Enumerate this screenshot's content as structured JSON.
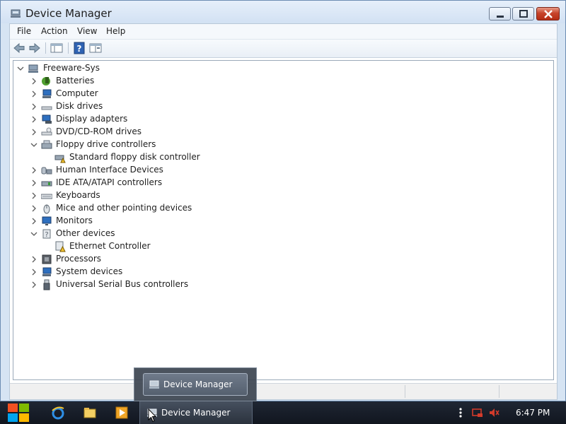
{
  "window": {
    "title": "Device Manager"
  },
  "menu": [
    "File",
    "Action",
    "View",
    "Help"
  ],
  "toolbar": {
    "back_icon": "back-arrow-icon",
    "forward_icon": "forward-arrow-icon",
    "show_hide_icon": "console-tree-icon",
    "help_icon": "help-icon",
    "properties_icon": "properties-icon"
  },
  "tree": {
    "root": "Freeware-Sys",
    "items": [
      {
        "label": "Batteries",
        "icon": "battery-icon",
        "expanded": false
      },
      {
        "label": "Computer",
        "icon": "computer-icon",
        "expanded": false
      },
      {
        "label": "Disk drives",
        "icon": "disk-drive-icon",
        "expanded": false
      },
      {
        "label": "Display adapters",
        "icon": "display-adapter-icon",
        "expanded": false
      },
      {
        "label": "DVD/CD-ROM drives",
        "icon": "dvd-drive-icon",
        "expanded": false
      },
      {
        "label": "Floppy drive controllers",
        "icon": "floppy-controller-icon",
        "expanded": true,
        "children": [
          {
            "label": "Standard floppy disk controller",
            "icon": "floppy-controller-warning-icon"
          }
        ]
      },
      {
        "label": "Human Interface Devices",
        "icon": "hid-icon",
        "expanded": false
      },
      {
        "label": "IDE ATA/ATAPI controllers",
        "icon": "ide-controller-icon",
        "expanded": false
      },
      {
        "label": "Keyboards",
        "icon": "keyboard-icon",
        "expanded": false
      },
      {
        "label": "Mice and other pointing devices",
        "icon": "mouse-icon",
        "expanded": false
      },
      {
        "label": "Monitors",
        "icon": "monitor-icon",
        "expanded": false
      },
      {
        "label": "Other devices",
        "icon": "other-devices-icon",
        "expanded": true,
        "children": [
          {
            "label": "Ethernet Controller",
            "icon": "unknown-device-warning-icon"
          }
        ]
      },
      {
        "label": "Processors",
        "icon": "processor-icon",
        "expanded": false
      },
      {
        "label": "System devices",
        "icon": "system-devices-icon",
        "expanded": false
      },
      {
        "label": "Universal Serial Bus controllers",
        "icon": "usb-icon",
        "expanded": false
      }
    ]
  },
  "taskbar": {
    "active_task": "Device Manager",
    "thumbnail_label": "Device Manager",
    "clock": "6:47 PM",
    "pinned": [
      "internet-explorer-icon",
      "file-explorer-icon",
      "media-player-icon"
    ]
  },
  "colors": {
    "close_red": "#c7442b",
    "window_frame": "#d6e4f3",
    "taskbar": "#11161f"
  }
}
